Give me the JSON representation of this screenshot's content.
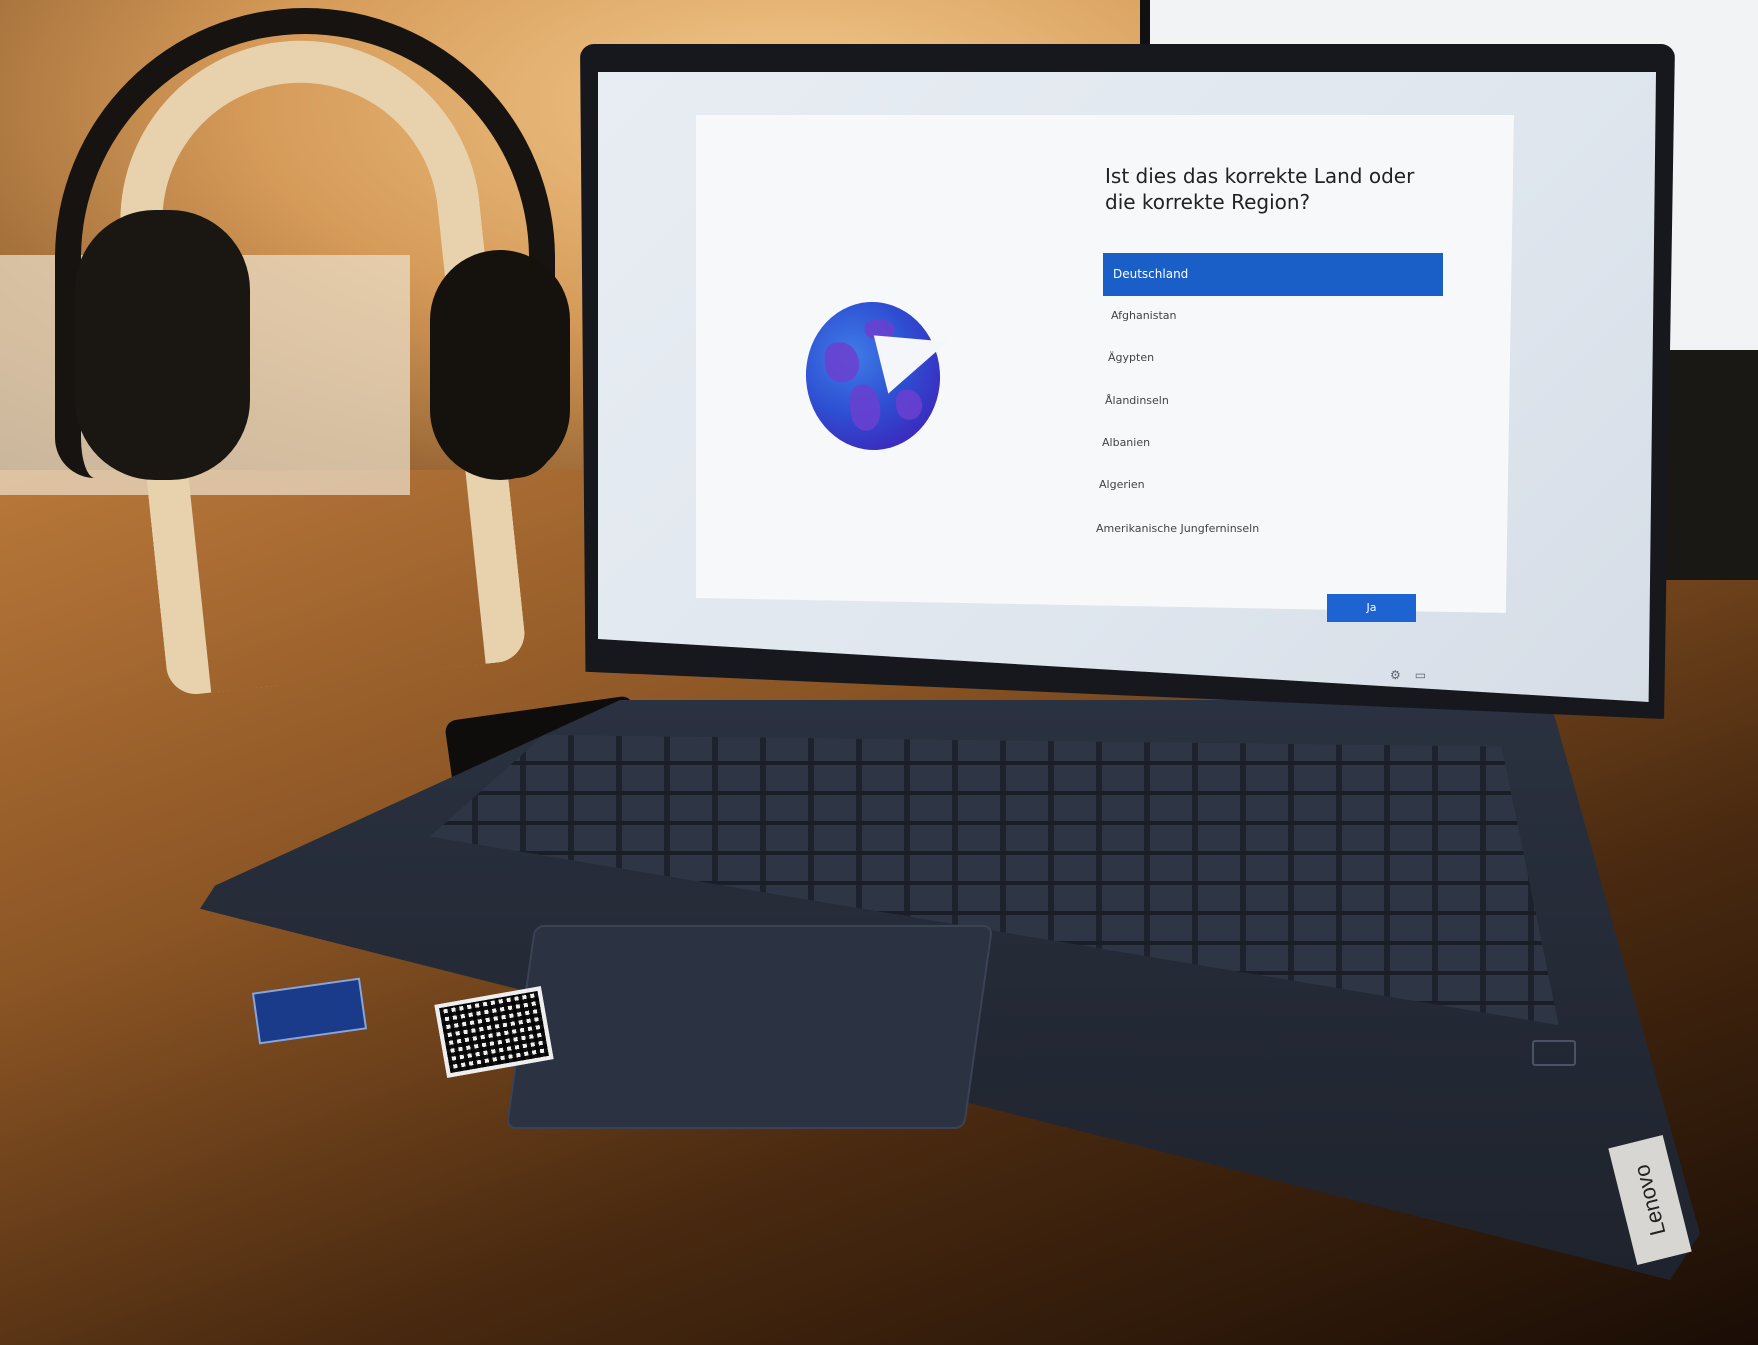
{
  "setup_dialog": {
    "question": "Ist dies das korrekte Land oder die korrekte Region?",
    "regions": [
      "Deutschland",
      "Afghanistan",
      "Ägypten",
      "Ålandinseln",
      "Albanien",
      "Algerien",
      "Amerikanische Jungferninseln"
    ],
    "selected_region": "Deutschland",
    "confirm_label": "Ja"
  },
  "laptop": {
    "brand_label": "Lenovo"
  },
  "colors": {
    "accent": "#1a5fc8",
    "globe": "#2e4fd2"
  }
}
